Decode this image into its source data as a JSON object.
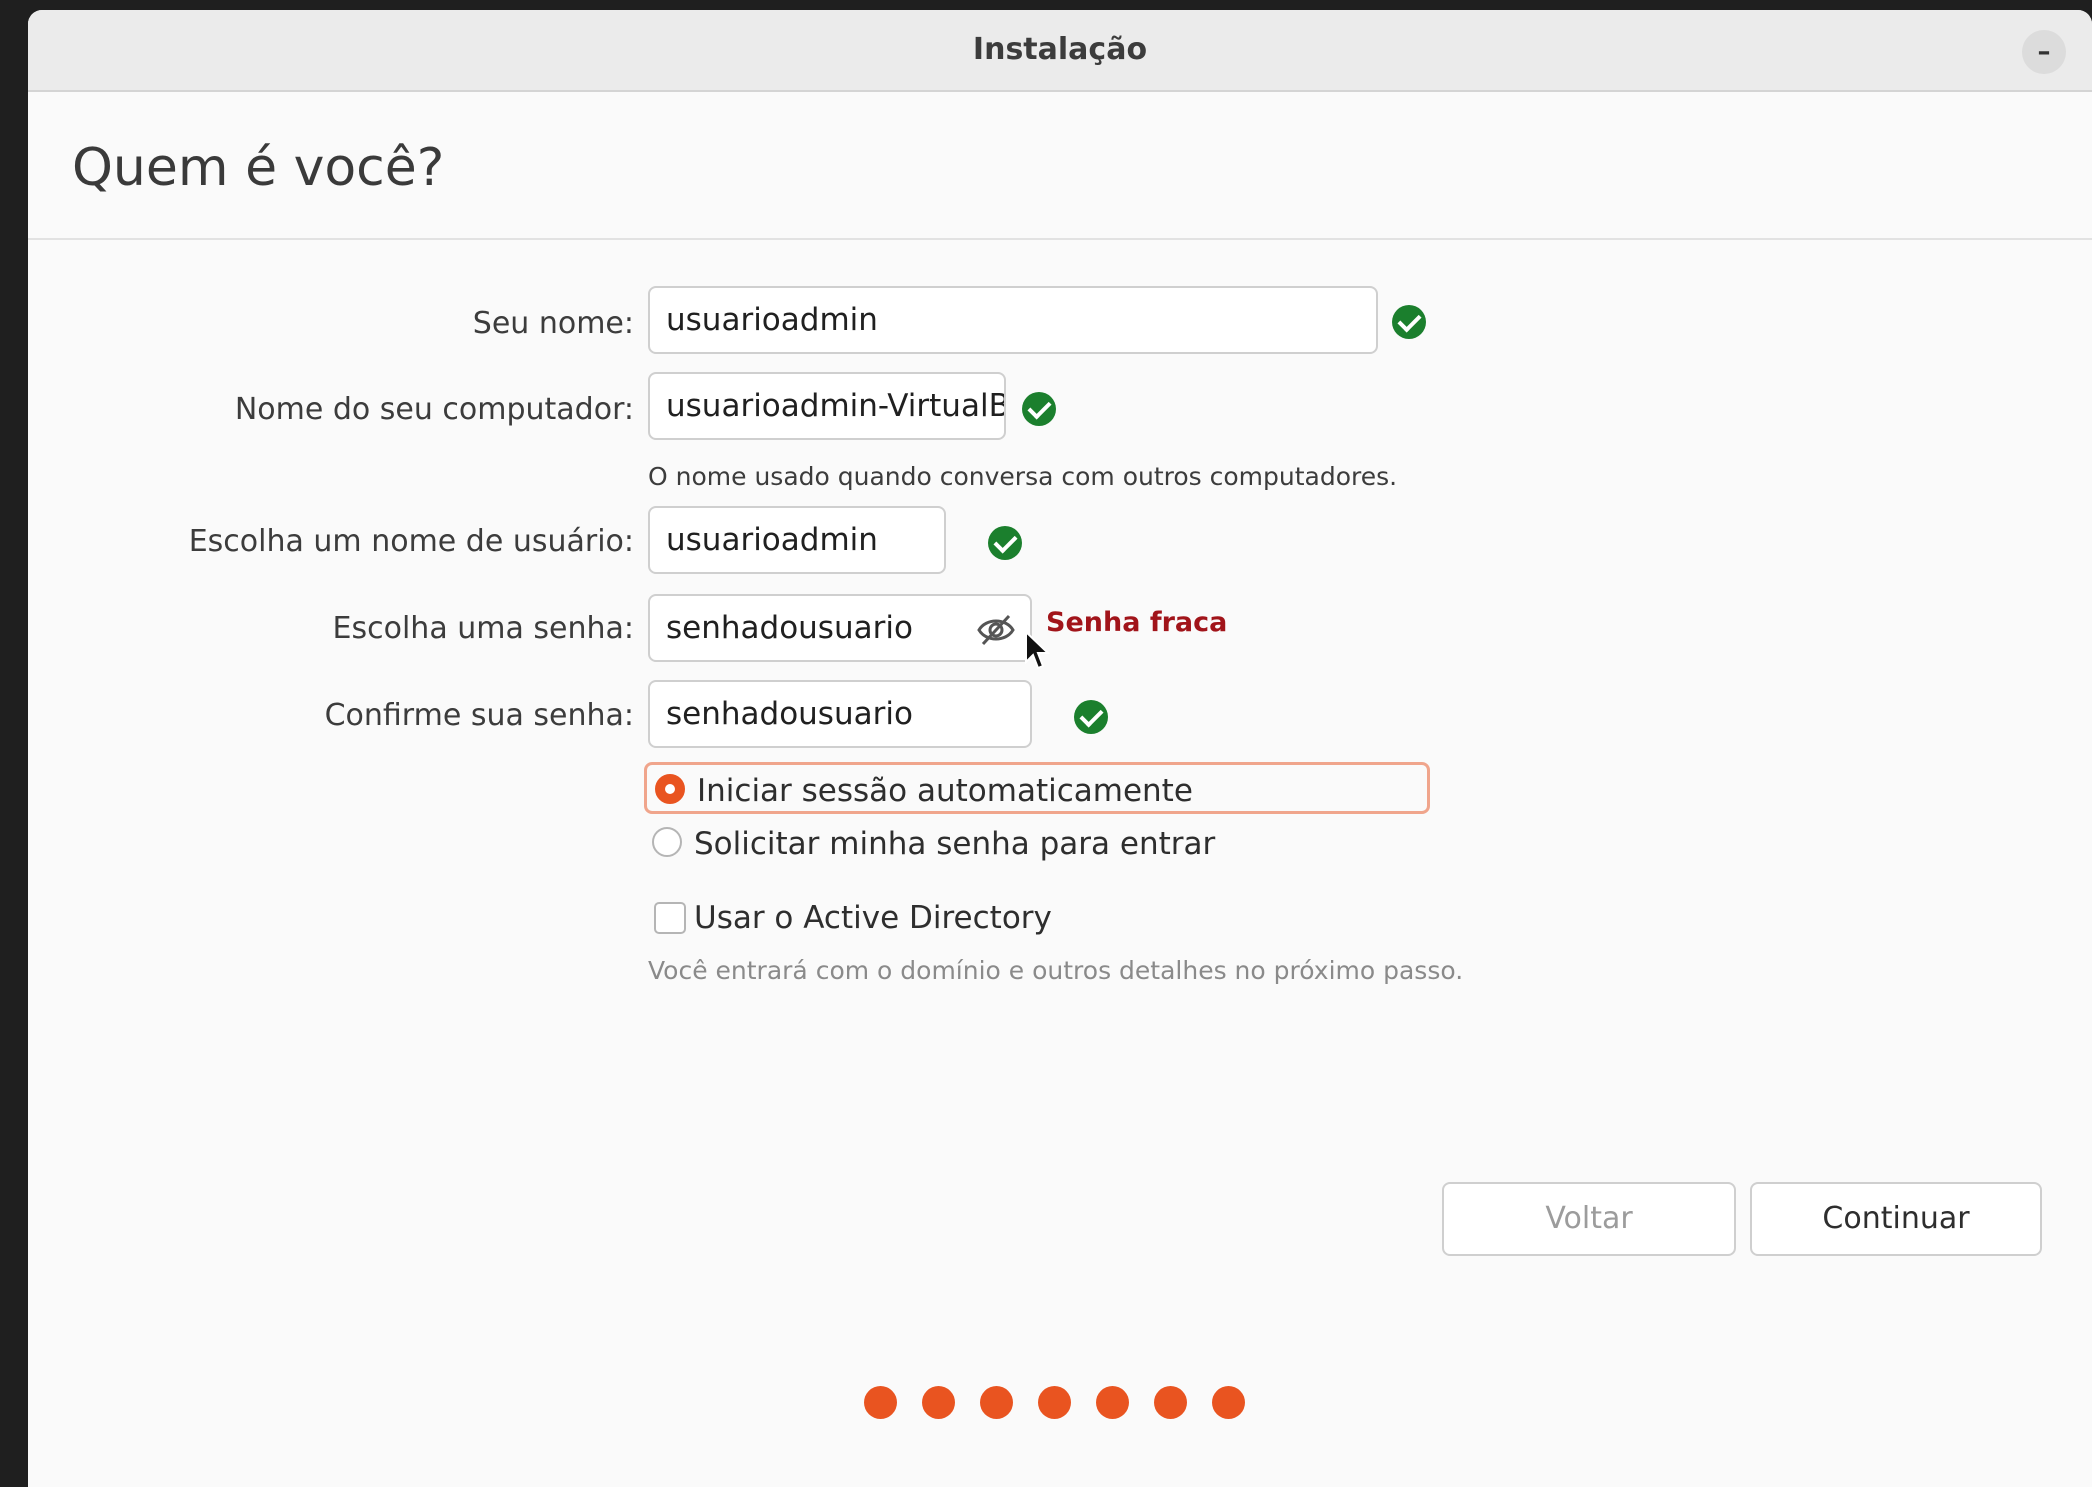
{
  "window": {
    "title": "Instalação",
    "minimize_label": "–"
  },
  "page": {
    "heading": "Quem é você?"
  },
  "form": {
    "name": {
      "label": "Seu nome:",
      "value": "usuarioadmin",
      "valid": true
    },
    "computer": {
      "label": "Nome do seu computador:",
      "value": "usuarioadmin-VirtualB",
      "valid": true,
      "hint": "O nome usado quando conversa com outros computadores."
    },
    "username": {
      "label": "Escolha um nome de usuário:",
      "value": "usuarioadmin",
      "valid": true
    },
    "password": {
      "label": "Escolha uma senha:",
      "value": "senhadousuario",
      "strength": "Senha fraca",
      "reveal_icon": "eye-slash-icon"
    },
    "confirm": {
      "label": "Confirme sua senha:",
      "value": "senhadousuario",
      "valid": true
    },
    "login_options": [
      {
        "label": "Iniciar sessão automaticamente",
        "selected": true
      },
      {
        "label": "Solicitar minha senha para entrar",
        "selected": false
      }
    ],
    "active_directory": {
      "label": "Usar o Active Directory",
      "checked": false,
      "hint": "Você entrará com o domínio e outros detalhes no próximo passo."
    }
  },
  "buttons": {
    "back": "Voltar",
    "continue": "Continuar"
  },
  "progress": {
    "total_steps": 7,
    "completed_steps": 7
  },
  "colors": {
    "accent": "#e95420",
    "valid": "#1b7f2d",
    "weak_password": "#a1141a"
  }
}
